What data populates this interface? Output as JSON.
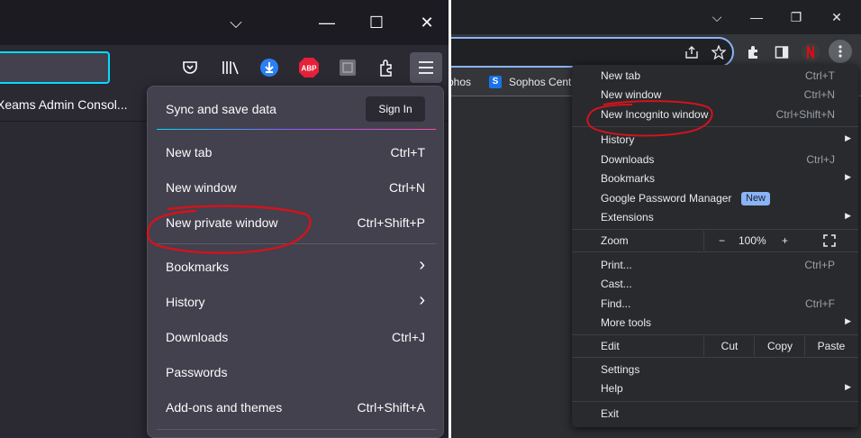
{
  "firefox": {
    "window_controls": [
      "⌵",
      "—",
      "☐",
      "✕"
    ],
    "toolbar_icons": [
      "pocket-icon",
      "library-icon",
      "download-icon",
      "abp-icon",
      "extension-square-icon",
      "extensions-icon"
    ],
    "abp_label": "ABP",
    "bookmark_label": "Xeams Admin Consol...",
    "menu": {
      "sync_label": "Sync and save data",
      "sign_in": "Sign In",
      "items": [
        {
          "label": "New tab",
          "shortcut": "Ctrl+T"
        },
        {
          "label": "New window",
          "shortcut": "Ctrl+N"
        },
        {
          "label": "New private window",
          "shortcut": "Ctrl+Shift+P"
        },
        {
          "label": "Bookmarks",
          "shortcut": ""
        },
        {
          "label": "History",
          "shortcut": ""
        },
        {
          "label": "Downloads",
          "shortcut": "Ctrl+J"
        },
        {
          "label": "Passwords",
          "shortcut": ""
        },
        {
          "label": "Add-ons and themes",
          "shortcut": "Ctrl+Shift+A"
        }
      ]
    }
  },
  "chrome": {
    "window_controls": [
      "⌵",
      "—",
      "❐",
      "✕"
    ],
    "bookmarks": [
      "phos",
      "Sophos Centr"
    ],
    "sophos_icon_letter": "S",
    "menu": {
      "items": [
        {
          "label": "New tab",
          "shortcut": "Ctrl+T"
        },
        {
          "label": "New window",
          "shortcut": "Ctrl+N"
        },
        {
          "label": "New Incognito window",
          "shortcut": "Ctrl+Shift+N"
        },
        {
          "label": "History",
          "shortcut": ""
        },
        {
          "label": "Downloads",
          "shortcut": "Ctrl+J"
        },
        {
          "label": "Bookmarks",
          "shortcut": ""
        },
        {
          "label": "Google Password Manager",
          "shortcut": "",
          "badge": "New"
        },
        {
          "label": "Extensions",
          "shortcut": ""
        },
        {
          "label": "Print...",
          "shortcut": "Ctrl+P"
        },
        {
          "label": "Cast...",
          "shortcut": ""
        },
        {
          "label": "Find...",
          "shortcut": "Ctrl+F"
        },
        {
          "label": "More tools",
          "shortcut": ""
        },
        {
          "label": "Settings",
          "shortcut": ""
        },
        {
          "label": "Help",
          "shortcut": ""
        },
        {
          "label": "Exit",
          "shortcut": ""
        }
      ],
      "zoom": {
        "label": "Zoom",
        "minus": "−",
        "value": "100%",
        "plus": "+"
      },
      "edit": {
        "label": "Edit",
        "cut": "Cut",
        "copy": "Copy",
        "paste": "Paste"
      }
    }
  },
  "colors": {
    "annotation": "#d3131d",
    "firefox_accent": "#00ddff",
    "chrome_accent": "#8ab4f8"
  }
}
